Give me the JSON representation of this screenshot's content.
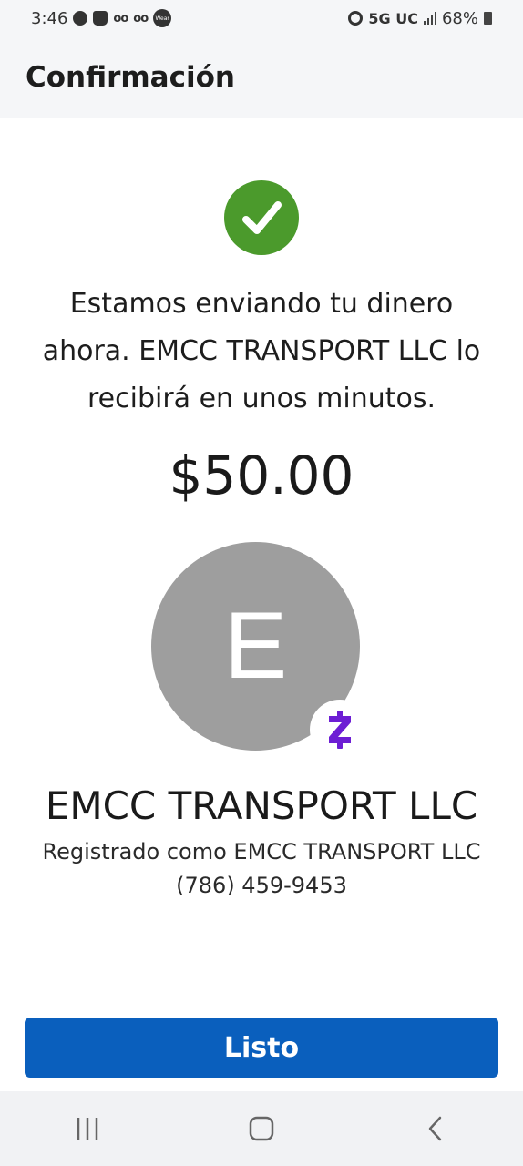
{
  "status_bar": {
    "time": "3:46",
    "voicemail_1": "oo",
    "voicemail_2": "oo",
    "wear_label": "Wear",
    "network": "5G UC",
    "battery": "68%"
  },
  "header": {
    "title": "Confirmación"
  },
  "confirmation": {
    "message": "Estamos enviando tu dinero ahora. EMCC TRANSPORT LLC lo recibirá en unos minutos.",
    "amount": "$50.00"
  },
  "recipient": {
    "initial": "E",
    "name": "EMCC TRANSPORT LLC",
    "registered_as": "Registrado como EMCC TRANSPORT LLC",
    "phone": "(786) 459-9453"
  },
  "actions": {
    "done_label": "Listo"
  },
  "colors": {
    "success_green": "#4b9a2c",
    "primary_blue": "#0a5fbd",
    "zelle_purple": "#6d1ed4",
    "avatar_gray": "#9e9e9e"
  },
  "icons": {
    "success": "check-icon",
    "zelle": "zelle-logo-icon",
    "nav_recents": "recents-icon",
    "nav_home": "home-icon",
    "nav_back": "back-icon"
  }
}
